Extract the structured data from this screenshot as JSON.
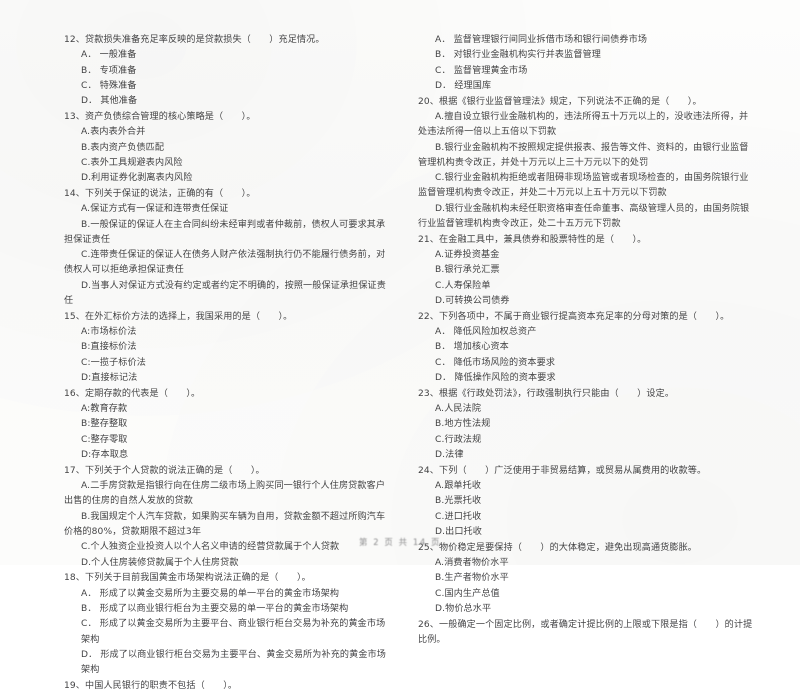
{
  "document": {
    "type": "scanned-exam-paper",
    "footer": "第 2 页 共 14 页"
  },
  "left_column": {
    "questions": [
      {
        "stem": "12、贷款损失准备充足率反映的是贷款损失（　　）充足情况。",
        "options": [
          "A． 一般准备",
          "B． 专项准备",
          "C． 特殊准备",
          "D． 其他准备"
        ]
      },
      {
        "stem": "13、资产负债综合管理的核心策略是（　　）。",
        "options": [
          "A.表内表外合并",
          "B.表内资产负债匹配",
          "C.表外工具规避表内风险",
          "D.利用证券化剥离表内风险"
        ]
      },
      {
        "stem": "14、下列关于保证的说法，正确的有（　　）。",
        "options": [
          "A.保证方式有一保证和连带责任保证",
          "B.一般保证的保证人在主合同纠纷未经审判或者仲裁前，债权人可要求其承担保证责任",
          "C.连带责任保证的保证人在债务人财产依法强制执行仍不能履行债务前，对债权人可以拒绝承担保证责任",
          "D.当事人对保证方式没有约定或者约定不明确的，按照一般保证承担保证责任"
        ]
      },
      {
        "stem": "15、在外汇标价方法的选择上，我国采用的是（　　）。",
        "options": [
          "A:市场标价法",
          "B:直接标价法",
          "C:一揽子标价法",
          "D:直接标记法"
        ]
      },
      {
        "stem": "16、定期存款的代表是（　　）。",
        "options": [
          "A:教育存款",
          "B:整存整取",
          "C:整存零取",
          "D:存本取息"
        ]
      },
      {
        "stem": "17、下列关于个人贷款的说法正确的是（　　）。",
        "options": [
          "A.二手房贷款是指银行向在住房二级市场上购买同一银行个人住房贷款客户出售的住房的自然人发放的贷款",
          "B.我国规定个人汽车贷款，如果购买车辆为自用，贷款金额不超过所购汽车价格的80%，贷款期限不超过3年",
          "C.个人独资企业投资人以个人名义申请的经营贷款属于个人贷款",
          "D.个人住房装修贷款属于个人住房贷款"
        ]
      },
      {
        "stem": "18、下列关于目前我国黄金市场架构说法正确的是（　　）。",
        "options": [
          "A． 形成了以黄金交易所为主要交易的单一平台的黄金市场架构",
          "B． 形成了以商业银行柜台为主要交易的单一平台的黄金市场架构",
          "C． 形成了以黄金交易所为主要平台、商业银行柜台交易为补充的黄金市场架构",
          "D． 形成了以商业银行柜台交易为主要平台、黄金交易所为补充的黄金市场架构"
        ]
      },
      {
        "stem": "19、中国人民银行的职责不包括（　　）。",
        "options": []
      }
    ]
  },
  "right_column": {
    "questions": [
      {
        "stem": "",
        "options": [
          "A． 监督管理银行间同业拆借市场和银行间债券市场",
          "B． 对银行业金融机构实行并表监督管理",
          "C． 监督管理黄金市场",
          "D． 经理国库"
        ]
      },
      {
        "stem": "20、根据《银行业监督管理法》规定，下列说法不正确的是（　　）。",
        "options": [
          "A.擅自设立银行业金融机构的，违法所得五十万元以上的，没收违法所得，并处违法所得一倍以上五倍以下罚款",
          "B.银行业金融机构不按照规定提供报表、报告等文件、资料的，由银行业监督管理机构责令改正，并处十万元以上三十万元以下的处罚",
          "C.银行业金融机构拒绝或者阻碍非现场监管或者现场检查的，由国务院银行业监督管理机构责令改正，并处二十万元以上五十万元以下罚款",
          "D.银行业金融机构未经任职资格审查任命董事、高级管理人员的，由国务院银行业监督管理机构责令改正，处二十五万元下罚款"
        ]
      },
      {
        "stem": "21、在金融工具中，兼具债券和股票特性的是（　　）。",
        "options": [
          "A.证券投资基金",
          "B.银行承兑汇票",
          "C.人寿保险单",
          "D.可转换公司债券"
        ]
      },
      {
        "stem": "22、下列各项中，不属于商业银行提高资本充足率的分母对策的是（　　）。",
        "options": [
          "A． 降低风险加权总资产",
          "B． 增加核心资本",
          "C． 降低市场风险的资本要求",
          "D． 降低操作风险的资本要求"
        ]
      },
      {
        "stem": "23、根据《行政处罚法》，行政强制执行只能由（　　）设定。",
        "options": [
          "A.人民法院",
          "B.地方性法规",
          "C.行政法规",
          "D.法律"
        ]
      },
      {
        "stem": "24、下列（　　）广泛使用于非贸易结算，或贸易从属费用的收款等。",
        "options": [
          "A.跟单托收",
          "B.光票托收",
          "C.进口托收",
          "D.出口托收"
        ]
      },
      {
        "stem": "25、物价稳定是要保持（　　）的大体稳定，避免出现高通货膨胀。",
        "options": [
          "A.消费者物价水平",
          "B.生产者物价水平",
          "C.国内生产总值",
          "D.物价总水平"
        ]
      },
      {
        "stem": "26、一般确定一个固定比例，或者确定计提比例的上限或下限是指（　　）的计提比例。",
        "options": []
      }
    ]
  }
}
